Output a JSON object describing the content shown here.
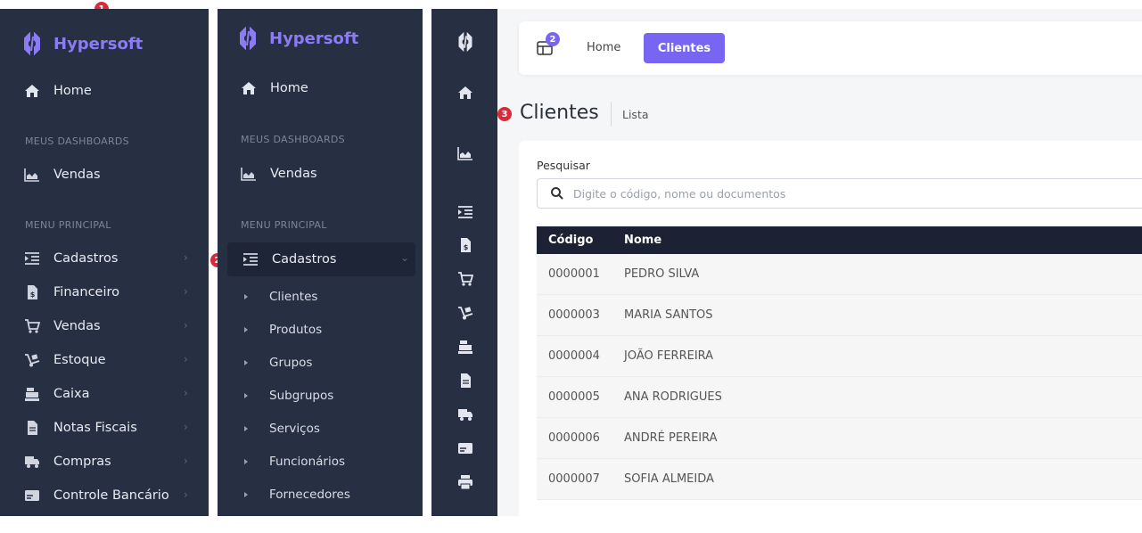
{
  "brand": {
    "name": "Hypersoft"
  },
  "badges": {
    "one": "1",
    "two": "2",
    "three": "3",
    "topbar": "2"
  },
  "sidebar": {
    "home": "Home",
    "section_dashboards": "MEUS DASHBOARDS",
    "vendas_dash": "Vendas",
    "section_menu": "MENU PRINCIPAL",
    "items": [
      {
        "label": "Cadastros",
        "icon": "list-indent-icon"
      },
      {
        "label": "Financeiro",
        "icon": "invoice-dollar-icon"
      },
      {
        "label": "Vendas",
        "icon": "cart-icon"
      },
      {
        "label": "Estoque",
        "icon": "dolly-icon"
      },
      {
        "label": "Caixa",
        "icon": "cash-register-icon"
      },
      {
        "label": "Notas Fiscais",
        "icon": "file-icon"
      },
      {
        "label": "Compras",
        "icon": "truck-icon"
      },
      {
        "label": "Controle Bancário",
        "icon": "card-icon"
      }
    ],
    "cadastros_sub": [
      "Clientes",
      "Produtos",
      "Grupos",
      "Subgrupos",
      "Serviços",
      "Funcionários",
      "Fornecedores"
    ]
  },
  "topbar": {
    "home": "Home",
    "active": "Clientes"
  },
  "page": {
    "title": "Clientes",
    "subtitle": "Lista"
  },
  "search": {
    "label": "Pesquisar",
    "placeholder": "Digite o código, nome ou documentos"
  },
  "table": {
    "headers": [
      "Código",
      "Nome"
    ],
    "rows": [
      [
        "0000001",
        "PEDRO SILVA"
      ],
      [
        "0000003",
        "MARIA SANTOS"
      ],
      [
        "0000004",
        "JOÃO FERREIRA"
      ],
      [
        "0000005",
        "ANA RODRIGUES"
      ],
      [
        "0000006",
        "ANDRÉ PEREIRA"
      ],
      [
        "0000007",
        "SOFIA ALMEIDA"
      ]
    ]
  },
  "colors": {
    "sidebar_bg": "#272f43",
    "accent": "#7866f2",
    "badge": "#d92a3a",
    "table_header": "#1c2133"
  }
}
